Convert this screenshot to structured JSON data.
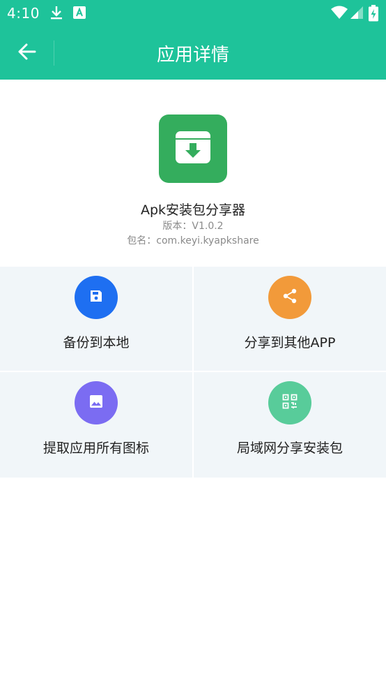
{
  "status_bar": {
    "time": "4:10",
    "left_icons": [
      "download-icon",
      "a-badge-icon"
    ],
    "right_icons": [
      "wifi-icon",
      "cellular-signal-icon",
      "battery-charging-icon"
    ]
  },
  "app_bar": {
    "back_icon": "arrow-left-icon",
    "title": "应用详情",
    "color": "#1ec39a"
  },
  "app_info": {
    "icon": "archive-download-icon",
    "icon_color": "#34ad5d",
    "name": "Apk安装包分享器",
    "version": "版本：V1.0.2",
    "package": "包名：com.keyi.kyapkshare"
  },
  "actions": [
    {
      "label": "备份到本地",
      "icon": "save-icon",
      "color": "#1e6ff1"
    },
    {
      "label": "分享到其他APP",
      "icon": "share-icon",
      "color": "#f29a3a"
    },
    {
      "label": "提取应用所有图标",
      "icon": "image-icon",
      "color": "#7b6cf2"
    },
    {
      "label": "局域网分享安装包",
      "icon": "qr-code-icon",
      "color": "#58cc9a"
    }
  ]
}
